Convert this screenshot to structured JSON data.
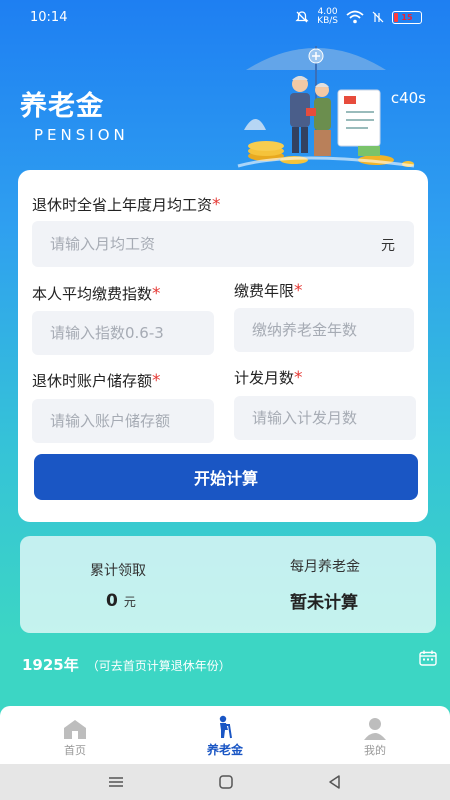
{
  "status": {
    "time": "10:14",
    "net_speed": "4.00",
    "net_unit": "KB/S",
    "battery": "15"
  },
  "header": {
    "title": "养老金",
    "subtitle": "PENSION",
    "code": "c40s"
  },
  "form": {
    "salary_label": "退休时全省上年度月均工资",
    "salary_placeholder": "请输入月均工资",
    "salary_unit": "元",
    "index_label": "本人平均缴费指数",
    "index_placeholder": "请输入指数0.6-3",
    "years_label": "缴费年限",
    "years_placeholder": "缴纳养老金年数",
    "savings_label": "退休时账户储存额",
    "savings_placeholder": "请输入账户储存额",
    "months_label": "计发月数",
    "months_placeholder": "请输入计发月数",
    "required_mark": "*",
    "submit_label": "开始计算"
  },
  "result": {
    "total_label": "累计领取",
    "total_value": "0",
    "total_unit": "元",
    "monthly_label": "每月养老金",
    "monthly_value": "暂未计算"
  },
  "retire": {
    "year": "1925年",
    "hint": "（可去首页计算退休年份）",
    "icon": "calendar-icon"
  },
  "tabs": [
    {
      "label": "首页",
      "icon": "home-icon"
    },
    {
      "label": "养老金",
      "icon": "elderly-icon"
    },
    {
      "label": "我的",
      "icon": "user-icon"
    }
  ],
  "colors": {
    "primary": "#1a56c4",
    "required": "#e53935",
    "gradient_top": "#1e7ff2",
    "gradient_bottom": "#3cd7c3"
  }
}
